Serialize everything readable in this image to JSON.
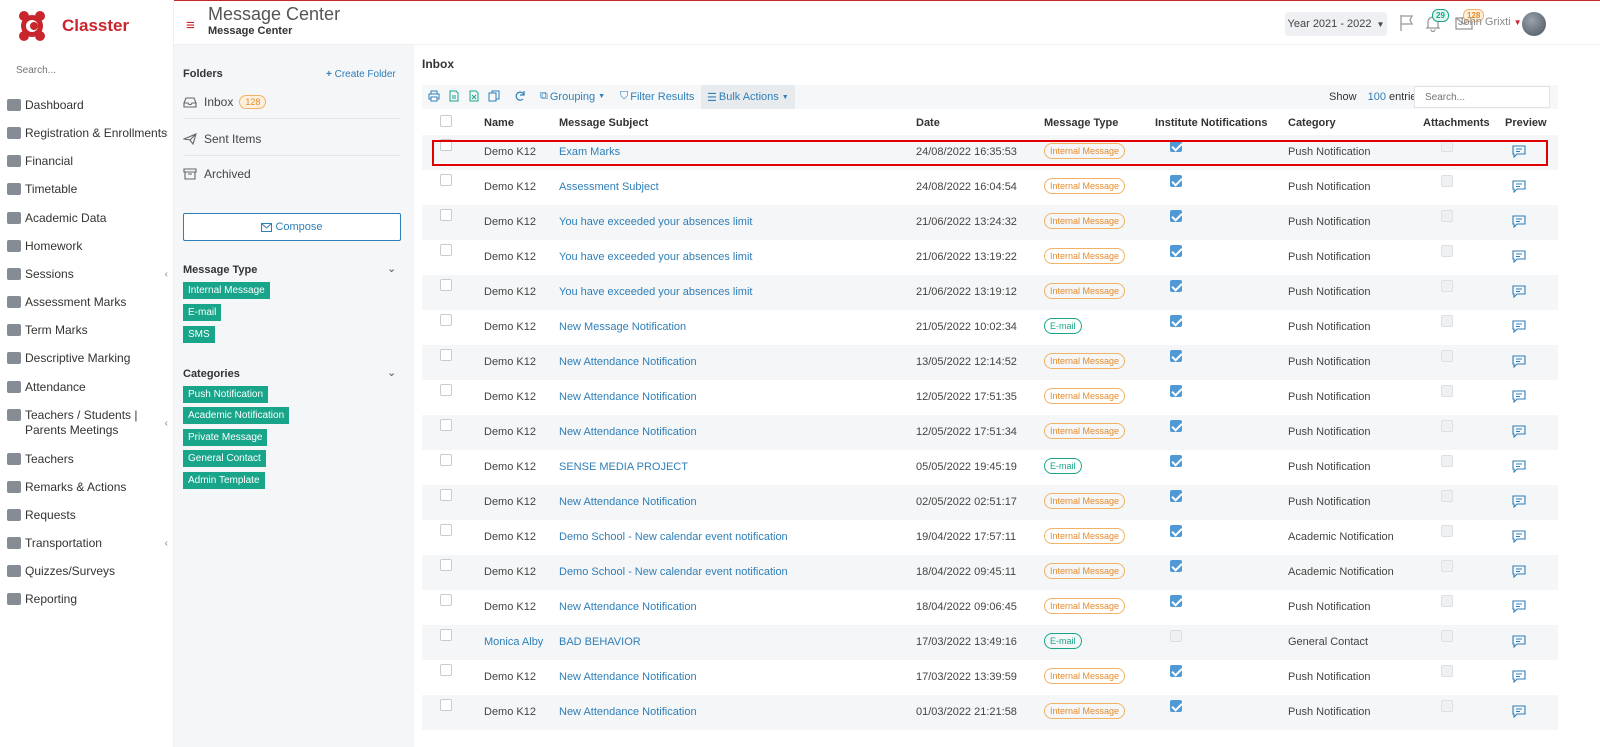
{
  "brand": {
    "name": "Classter",
    "accent": "#c9252c",
    "teal": "#18a589",
    "link": "#2f7fb8"
  },
  "sidebar": {
    "search_placeholder": "Search...",
    "items": [
      {
        "label": "Dashboard",
        "icon": "laptop-icon"
      },
      {
        "label": "Registration & Enrollments",
        "icon": "institution-icon",
        "submenu": "‹"
      },
      {
        "label": "Financial",
        "icon": "coins-icon"
      },
      {
        "label": "Timetable",
        "icon": "calendar-icon"
      },
      {
        "label": "Academic Data",
        "icon": "user-card-icon"
      },
      {
        "label": "Homework",
        "icon": "list-icon"
      },
      {
        "label": "Sessions",
        "icon": "chalkboard-icon",
        "submenu": "‹"
      },
      {
        "label": "Assessment Marks",
        "icon": "edit-icon"
      },
      {
        "label": "Term Marks",
        "icon": "folder-icon"
      },
      {
        "label": "Descriptive Marking",
        "icon": "check-square-icon"
      },
      {
        "label": "Attendance",
        "icon": "user-check-icon"
      },
      {
        "label": "Teachers / Students | Parents Meetings",
        "icon": "users-gear-icon",
        "submenu": "‹"
      },
      {
        "label": "Teachers",
        "icon": "users-icon"
      },
      {
        "label": "Remarks & Actions",
        "icon": "shuffle-icon"
      },
      {
        "label": "Requests",
        "icon": "document-icon"
      },
      {
        "label": "Transportation",
        "icon": "bus-icon",
        "submenu": "‹"
      },
      {
        "label": "Quizzes/Surveys",
        "icon": "clipboard-icon"
      },
      {
        "label": "Reporting",
        "icon": "printer-icon"
      }
    ]
  },
  "header": {
    "title": "Message Center",
    "subtitle": "Message Center",
    "year": "Year 2021 - 2022",
    "notifications_count": "29",
    "messages_count": "128",
    "user_name": "John Grixti"
  },
  "folders": {
    "title": "Folders",
    "create_label": "Create Folder",
    "inbox": "Inbox",
    "inbox_count": "128",
    "sent": "Sent Items",
    "archived": "Archived",
    "compose": "Compose"
  },
  "filters": {
    "message_type_title": "Message Type",
    "message_types": [
      "Internal Message",
      "E-mail",
      "SMS"
    ],
    "categories_title": "Categories",
    "categories": [
      "Push Notification",
      "Academic Notification",
      "Private Message",
      "General Contact",
      "Admin Template"
    ]
  },
  "inbox": {
    "title": "Inbox",
    "toolbar": {
      "grouping": "Grouping",
      "filter": "Filter Results",
      "bulk": "Bulk Actions"
    },
    "show_label": "Show",
    "show_count": "100",
    "entries_label": "entries",
    "search_placeholder": "Search...",
    "columns": [
      "Name",
      "Message Subject",
      "Date",
      "Message Type",
      "Institute Notifications",
      "Category",
      "Attachments",
      "Preview"
    ],
    "rows": [
      {
        "name": "Demo K12",
        "subject": "Exam Marks",
        "date": "24/08/2022 16:35:53",
        "type": "Internal Message",
        "inst": true,
        "category": "Push Notification"
      },
      {
        "name": "Demo K12",
        "subject": "Assessment Subject",
        "date": "24/08/2022 16:04:54",
        "type": "Internal Message",
        "inst": true,
        "category": "Push Notification"
      },
      {
        "name": "Demo K12",
        "subject": "You have exceeded your absences limit",
        "date": "21/06/2022 13:24:32",
        "type": "Internal Message",
        "inst": true,
        "category": "Push Notification"
      },
      {
        "name": "Demo K12",
        "subject": "You have exceeded your absences limit",
        "date": "21/06/2022 13:19:22",
        "type": "Internal Message",
        "inst": true,
        "category": "Push Notification"
      },
      {
        "name": "Demo K12",
        "subject": "You have exceeded your absences limit",
        "date": "21/06/2022 13:19:12",
        "type": "Internal Message",
        "inst": true,
        "category": "Push Notification"
      },
      {
        "name": "Demo K12",
        "subject": "New Message Notification",
        "date": "21/05/2022 10:02:34",
        "type": "E-mail",
        "inst": true,
        "category": "Push Notification"
      },
      {
        "name": "Demo K12",
        "subject": "New Attendance Notification",
        "date": "13/05/2022 12:14:52",
        "type": "Internal Message",
        "inst": true,
        "category": "Push Notification"
      },
      {
        "name": "Demo K12",
        "subject": "New Attendance Notification",
        "date": "12/05/2022 17:51:35",
        "type": "Internal Message",
        "inst": true,
        "category": "Push Notification"
      },
      {
        "name": "Demo K12",
        "subject": "New Attendance Notification",
        "date": "12/05/2022 17:51:34",
        "type": "Internal Message",
        "inst": true,
        "category": "Push Notification"
      },
      {
        "name": "Demo K12",
        "subject": "SENSE MEDIA PROJECT",
        "date": "05/05/2022 19:45:19",
        "type": "E-mail",
        "inst": true,
        "category": "Push Notification"
      },
      {
        "name": "Demo K12",
        "subject": "New Attendance Notification",
        "date": "02/05/2022 02:51:17",
        "type": "Internal Message",
        "inst": true,
        "category": "Push Notification"
      },
      {
        "name": "Demo K12",
        "subject": "Demo School - New calendar event notification",
        "date": "19/04/2022 17:57:11",
        "type": "Internal Message",
        "inst": true,
        "category": "Academic Notification"
      },
      {
        "name": "Demo K12",
        "subject": "Demo School - New calendar event notification",
        "date": "18/04/2022 09:45:11",
        "type": "Internal Message",
        "inst": true,
        "category": "Academic Notification"
      },
      {
        "name": "Demo K12",
        "subject": "New Attendance Notification",
        "date": "18/04/2022 09:06:45",
        "type": "Internal Message",
        "inst": true,
        "category": "Push Notification"
      },
      {
        "name": "Monica Alby",
        "subject": "BAD BEHAVIOR",
        "date": "17/03/2022 13:49:16",
        "type": "E-mail",
        "inst": false,
        "category": "General Contact",
        "name_link": true
      },
      {
        "name": "Demo K12",
        "subject": "New Attendance Notification",
        "date": "17/03/2022 13:39:59",
        "type": "Internal Message",
        "inst": true,
        "category": "Push Notification"
      },
      {
        "name": "Demo K12",
        "subject": "New Attendance Notification",
        "date": "01/03/2022 21:21:58",
        "type": "Internal Message",
        "inst": true,
        "category": "Push Notification"
      }
    ]
  }
}
